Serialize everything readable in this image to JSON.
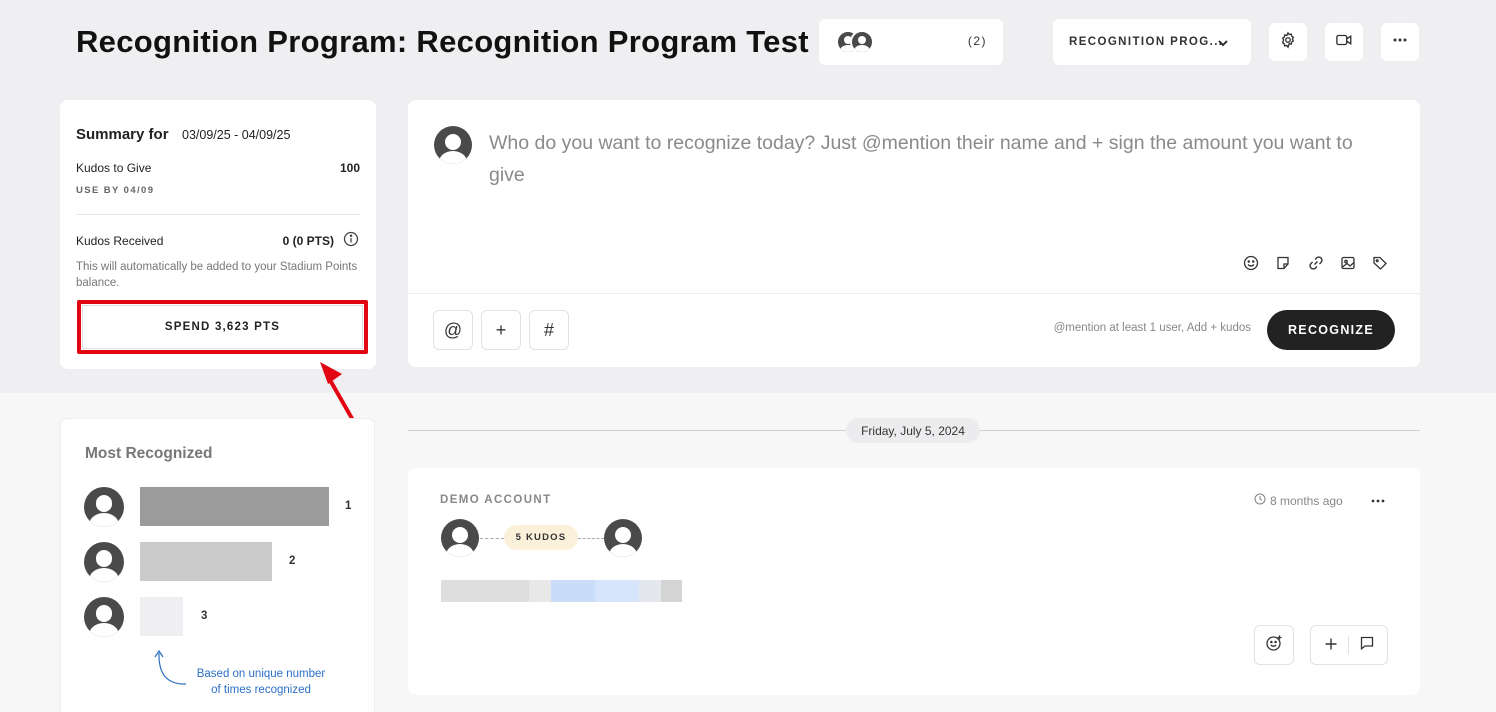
{
  "header": {
    "title": "Recognition Program: Recognition Program Test",
    "members_count": "(2)",
    "program_select": "RECOGNITION PROG...",
    "icons": [
      "gear-icon",
      "video-icon",
      "more-icon"
    ]
  },
  "summary": {
    "title": "Summary for",
    "range": "03/09/25 - 04/09/25",
    "kudos_to_give_label": "Kudos to Give",
    "kudos_to_give_value": "100",
    "use_by": "USE BY 04/09",
    "kudos_received_label": "Kudos Received",
    "kudos_received_value": "0 (0 PTS)",
    "helper": "This will automatically be added to your Stadium Points balance.",
    "spend_button": "SPEND 3,623 PTS"
  },
  "composer": {
    "placeholder": "Who do you want to recognize today? Just @mention their name and + sign the amount you want to give",
    "toolbar_icons": [
      "emoji-icon",
      "sticker-icon",
      "link-icon",
      "image-icon",
      "tag-icon"
    ],
    "buttons": {
      "mention": "@",
      "add": "+",
      "hashtag": "#"
    },
    "hint": "@mention at least 1 user,  Add + kudos",
    "recognize": "RECOGNIZE"
  },
  "most_recognized": {
    "title": "Most Recognized",
    "entries": [
      {
        "rank": "1",
        "share": 1.0,
        "color": "#9b9b9b"
      },
      {
        "rank": "2",
        "share": 0.7,
        "color": "#cacaca"
      },
      {
        "rank": "3",
        "share": 0.23,
        "color": "#efeff1"
      }
    ],
    "footnote": "Based on unique number of times recognized"
  },
  "feed": {
    "date": "Friday, July 5, 2024",
    "post": {
      "author": "DEMO ACCOUNT",
      "time": "8 months ago",
      "kudos": "5 KUDOS"
    }
  },
  "colors": {
    "highlight": "#e20612",
    "primary_button": "#222222",
    "footnote": "#2b6fc4",
    "kudos_badge": "#fbf0d9"
  }
}
